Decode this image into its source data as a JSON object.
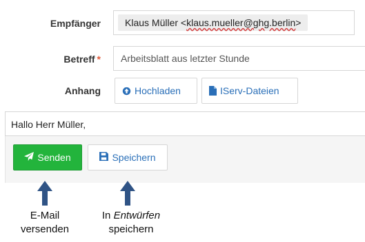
{
  "form": {
    "recipient_label": "Empfänger",
    "recipient_name": "Klaus Müller <",
    "recipient_email": "klaus.mueller@ghg.berlin",
    "recipient_close": ">",
    "subject_label": "Betreff",
    "subject_required_mark": "*",
    "subject_value": "Arbeitsblatt aus letzter Stunde",
    "attachment_label": "Anhang",
    "upload_button": "Hochladen",
    "iserv_files_button": "IServ-Dateien",
    "body_text": "Hallo Herr Müller,"
  },
  "toolbar": {
    "send_button": "Senden",
    "save_button": "Speichern",
    "send_color": "#23b43c",
    "link_color": "#2a6fb8"
  },
  "annotations": {
    "send_caption_line1": "E-Mail",
    "send_caption_line2": "versenden",
    "save_caption_prefix": "In ",
    "save_caption_italic": "Entwürfen",
    "save_caption_line2": "speichern"
  },
  "icons": [
    "upload-circle-icon",
    "file-icon",
    "paper-plane-icon",
    "floppy-disk-icon",
    "up-arrow-icon"
  ]
}
